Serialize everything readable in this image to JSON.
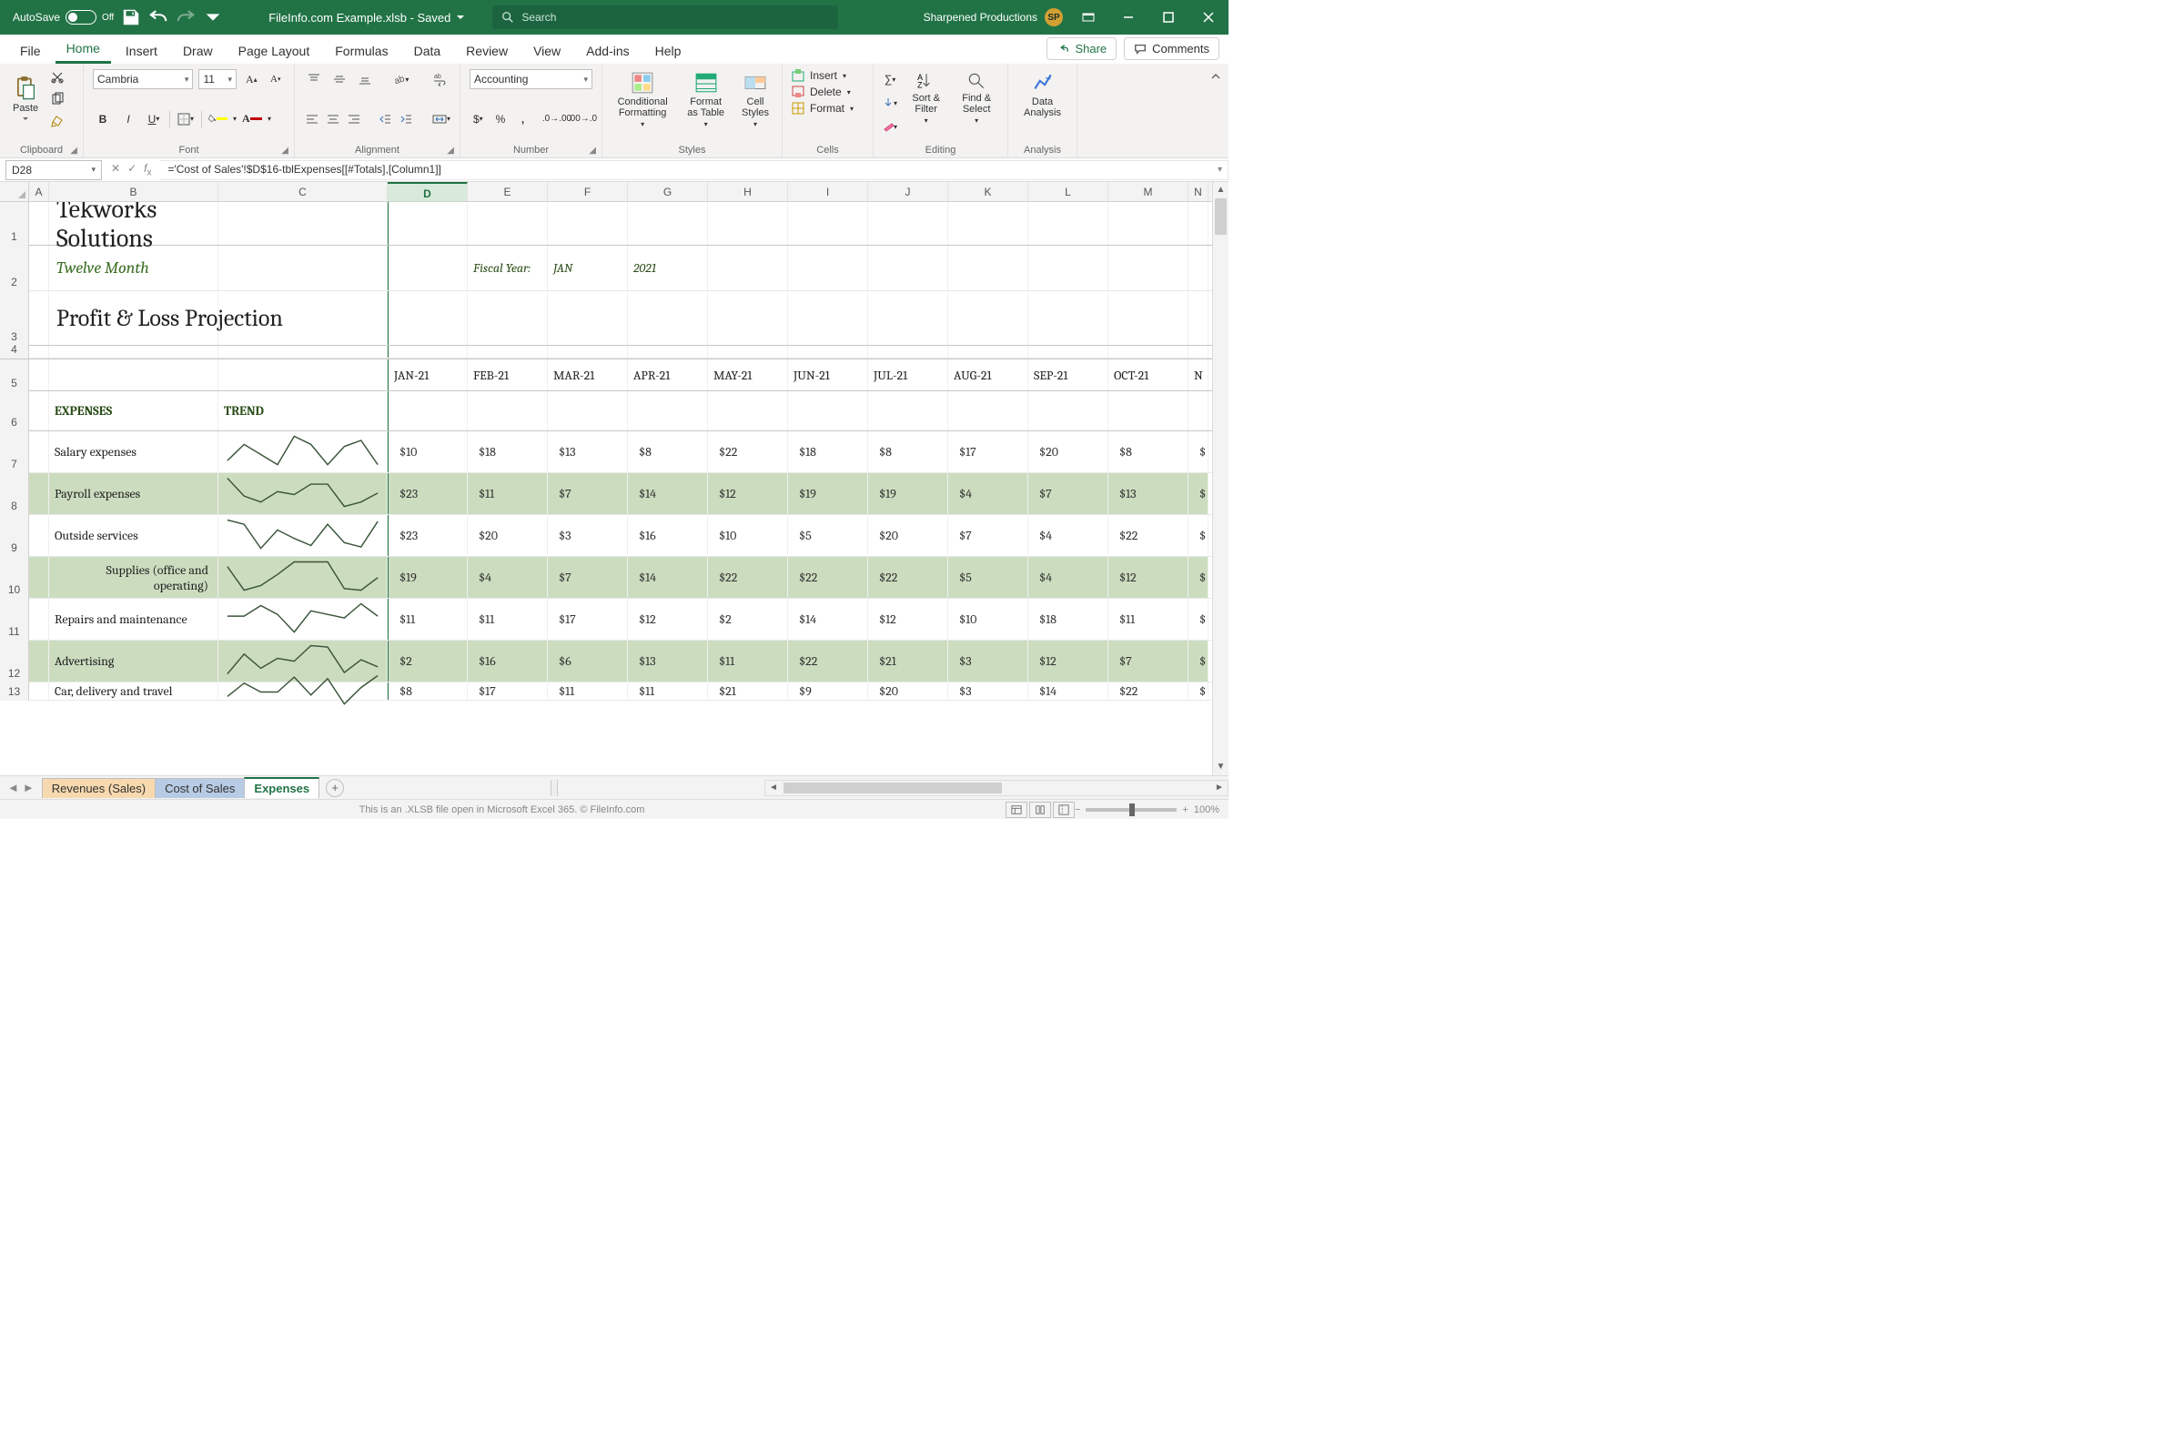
{
  "titlebar": {
    "autosave_label": "AutoSave",
    "autosave_state": "Off",
    "doc_title": "FileInfo.com Example.xlsb - Saved",
    "search_placeholder": "Search",
    "account_name": "Sharpened Productions",
    "account_initials": "SP"
  },
  "tabs": {
    "items": [
      "File",
      "Home",
      "Insert",
      "Draw",
      "Page Layout",
      "Formulas",
      "Data",
      "Review",
      "View",
      "Add-ins",
      "Help"
    ],
    "active": "Home",
    "share": "Share",
    "comments": "Comments"
  },
  "ribbon": {
    "clipboard": {
      "paste": "Paste",
      "label": "Clipboard"
    },
    "font": {
      "name": "Cambria",
      "size": "11",
      "label": "Font",
      "fill": "#ffff00",
      "color": "#c00000"
    },
    "alignment": {
      "label": "Alignment"
    },
    "number": {
      "format": "Accounting",
      "label": "Number"
    },
    "styles": {
      "cond": "Conditional Formatting",
      "fat": "Format as Table",
      "cstyle": "Cell Styles",
      "label": "Styles"
    },
    "cells": {
      "insert": "Insert",
      "delete": "Delete",
      "format": "Format",
      "label": "Cells"
    },
    "editing": {
      "sort": "Sort & Filter",
      "find": "Find & Select",
      "label": "Editing"
    },
    "analysis": {
      "btn": "Data Analysis",
      "label": "Analysis"
    }
  },
  "formula_bar": {
    "cell_ref": "D28",
    "formula": "='Cost of Sales'!$D$16-tblExpenses[[#Totals],[Column1]]"
  },
  "columns": [
    "A",
    "B",
    "C",
    "D",
    "E",
    "F",
    "G",
    "H",
    "I",
    "J",
    "K",
    "L",
    "M",
    "N"
  ],
  "doc": {
    "company": "Tekworks Solutions",
    "subtitle": "Twelve Month",
    "section": "Profit & Loss Projection",
    "fy_label": "Fiscal Year:",
    "fy_month": "JAN",
    "fy_year": "2021"
  },
  "month_headers": [
    "JAN-21",
    "FEB-21",
    "MAR-21",
    "APR-21",
    "MAY-21",
    "JUN-21",
    "JUL-21",
    "AUG-21",
    "SEP-21",
    "OCT-21"
  ],
  "partial_next": "N",
  "table": {
    "col_expenses": "EXPENSES",
    "col_trend": "TREND",
    "rows": [
      {
        "name": "Salary expenses",
        "vals": [
          10,
          18,
          13,
          8,
          22,
          18,
          8,
          17,
          20,
          8
        ]
      },
      {
        "name": "Payroll expenses",
        "vals": [
          23,
          11,
          7,
          14,
          12,
          19,
          19,
          4,
          7,
          13
        ]
      },
      {
        "name": "Outside services",
        "vals": [
          23,
          20,
          3,
          16,
          10,
          5,
          20,
          7,
          4,
          22
        ]
      },
      {
        "name": "Supplies (office and operating)",
        "vals": [
          19,
          4,
          7,
          14,
          22,
          22,
          22,
          5,
          4,
          12
        ]
      },
      {
        "name": "Repairs and maintenance",
        "vals": [
          11,
          11,
          17,
          12,
          2,
          14,
          12,
          10,
          18,
          11
        ]
      },
      {
        "name": "Advertising",
        "vals": [
          2,
          16,
          6,
          13,
          11,
          22,
          21,
          3,
          12,
          7
        ]
      },
      {
        "name": "Car, delivery and travel",
        "vals": [
          8,
          17,
          11,
          11,
          21,
          9,
          20,
          3,
          14,
          22
        ]
      }
    ]
  },
  "sheets": {
    "names": [
      "Revenues (Sales)",
      "Cost of Sales",
      "Expenses"
    ],
    "active": 2
  },
  "status": {
    "footer": "This is an .XLSB file open in Microsoft Excel 365. © FileInfo.com",
    "zoom": "100%"
  },
  "colors": {
    "brand": "#217346"
  }
}
